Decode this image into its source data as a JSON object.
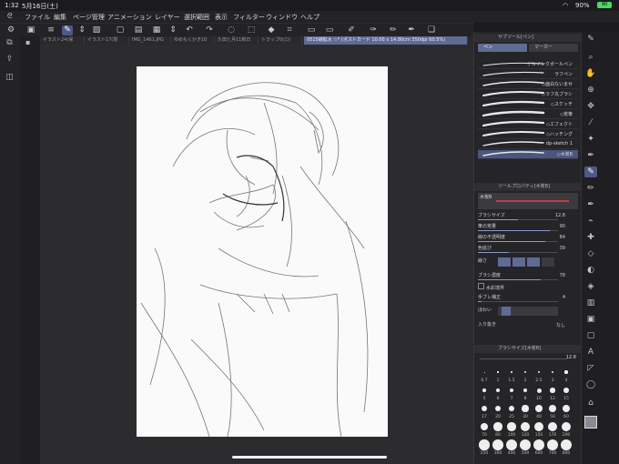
{
  "status": {
    "time": "1:32",
    "date": "5月16日(土)",
    "battery": "90%",
    "battery_badge": "90"
  },
  "menu": [
    "ファイル",
    "編集",
    "ページ管理",
    "アニメーション",
    "レイヤー",
    "選択範囲",
    "表示",
    "フィルター",
    "ウィンドウ",
    "ヘルプ"
  ],
  "tabs": [
    {
      "label": "イラスト24(保",
      "active": false
    },
    {
      "label": "イラスト17(現",
      "active": false
    },
    {
      "label": "IMG_1461.JPG",
      "active": false
    },
    {
      "label": "ゆめもくかき10",
      "active": false
    },
    {
      "label": "久田と月11新日",
      "active": false
    },
    {
      "label": "トラップ0(ロ)",
      "active": false
    },
    {
      "label": "0515線拡大 ☆* (ポストカード 10.00 x 14.80cm 350dpi 60.5%)",
      "active": true
    }
  ],
  "subtool_panel": {
    "title": "サブツール[ペン]",
    "tab_pen": "ペン",
    "tab_marker": "マーカー"
  },
  "brushes": [
    {
      "label": "ゲルインクボールペン",
      "selected": false
    },
    {
      "label": "ラフペン",
      "selected": false
    },
    {
      "label": "◇面白ないませ",
      "selected": false
    },
    {
      "label": "◇ラフ丸ブラシ",
      "selected": false
    },
    {
      "label": "◇スケッチ",
      "selected": false
    },
    {
      "label": "◇荒筆",
      "selected": false
    },
    {
      "label": "◇エフェクト",
      "selected": false
    },
    {
      "label": "◇ハッチング",
      "selected": false
    },
    {
      "label": "dp-sketch 1",
      "selected": false
    },
    {
      "label": "◇木炭B",
      "selected": true
    }
  ],
  "tool_property": {
    "title": "ツールプロパティ[木炭B]",
    "preset_label": "木炭B",
    "items": [
      {
        "label": "ブラシサイズ",
        "value": "12.8",
        "fraction": 0.5
      },
      {
        "label": "筆の荒量",
        "value": "90",
        "fraction": 0.9
      },
      {
        "label": "線の不透明度",
        "value": "84",
        "fraction": 0.84
      },
      {
        "label": "色延び",
        "value": "39",
        "fraction": 0.39
      },
      {
        "label": "線さ",
        "value": "",
        "fraction": 0
      },
      {
        "label": "ブラシ濃度",
        "value": "78",
        "fraction": 0.78
      },
      {
        "label": "水彩境界",
        "value": "",
        "fraction": 0
      },
      {
        "label": "手ブレ補正",
        "value": "4",
        "fraction": 0.04
      },
      {
        "label": "ほわい",
        "value": "",
        "fraction": 0
      },
      {
        "label": "入り抜き",
        "value": "なし",
        "fraction": 0
      }
    ]
  },
  "brush_size_panel": {
    "title": "ブラシサイズ[木炭B]",
    "current": "12.8",
    "row1": [
      "0.7",
      "1",
      "1.5",
      "2",
      "2.5",
      "3",
      "4"
    ],
    "row2": [
      "5",
      "6",
      "7",
      "8",
      "10",
      "12",
      "15"
    ],
    "row3": [
      "17",
      "20",
      "25",
      "30",
      "40",
      "50",
      "60"
    ],
    "row4": [
      "70",
      "80",
      "100",
      "120",
      "150",
      "170",
      "200"
    ],
    "row5": [
      "250",
      "300",
      "400",
      "500",
      "600",
      "700",
      "800"
    ]
  },
  "colors": {
    "accent": "#4b5a86",
    "main_color": "#8a8a95",
    "sub_color": "#ffffff",
    "battery": "#4cd964"
  }
}
